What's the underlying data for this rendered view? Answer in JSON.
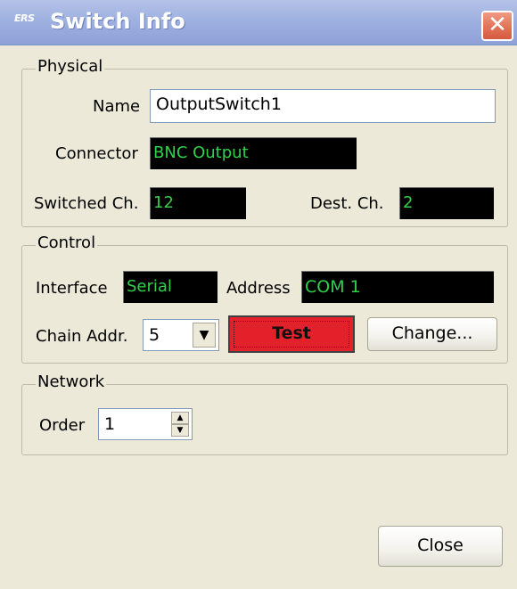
{
  "window": {
    "title": "Switch Info",
    "app_icon_text": "ERS",
    "close_glyph": "✕"
  },
  "physical": {
    "legend": "Physical",
    "name_label": "Name",
    "name_value": "OutputSwitch1",
    "connector_label": "Connector",
    "connector_value": "BNC Output",
    "switched_ch_label": "Switched Ch.",
    "switched_ch_value": "12",
    "dest_ch_label": "Dest. Ch.",
    "dest_ch_value": "2"
  },
  "control": {
    "legend": "Control",
    "interface_label": "Interface",
    "interface_value": "Serial",
    "address_label": "Address",
    "address_value": "COM 1",
    "chain_addr_label": "Chain Addr.",
    "chain_addr_value": "5",
    "test_label": "Test",
    "change_label": "Change..."
  },
  "network": {
    "legend": "Network",
    "order_label": "Order",
    "order_value": "1"
  },
  "footer": {
    "close_label": "Close"
  },
  "icons": {
    "dropdown": "chevron-down-icon",
    "spin_up": "triangle-up-icon",
    "spin_down": "triangle-down-icon"
  },
  "colors": {
    "window_bg": "#ece9d8",
    "titlebar": "#9fb1e0",
    "readout_bg": "#000000",
    "readout_text": "#31d04a",
    "test_button": "#e4202a",
    "close_x": "#e27359"
  }
}
